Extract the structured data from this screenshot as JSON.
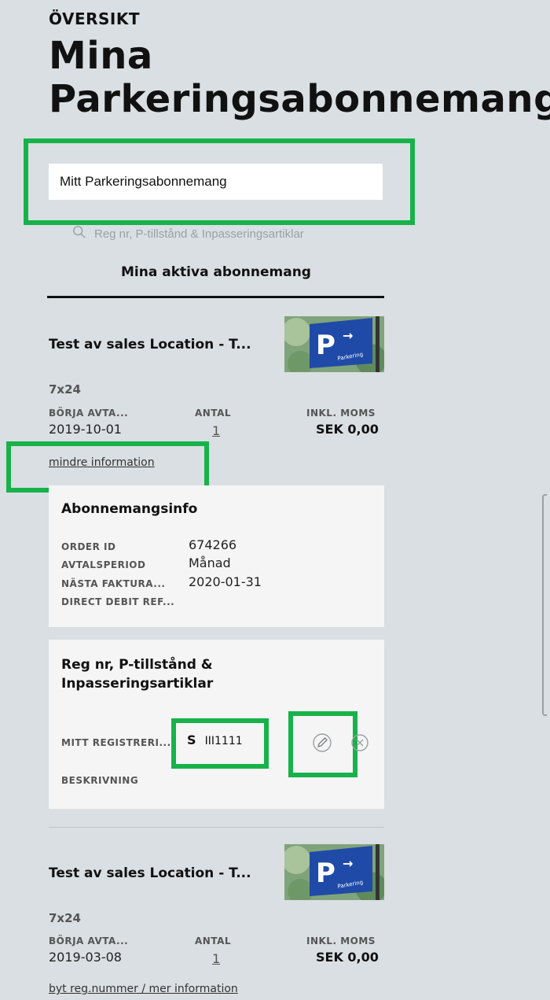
{
  "header": {
    "eyebrow": "ÖVERSIKT",
    "title_line1": "Mina",
    "title_line2": "Parkeringsabonnemang"
  },
  "selector": {
    "value": "Mitt Parkeringsabonnemang"
  },
  "search": {
    "placeholder": "Reg nr, P-tillstånd & Inpasseringsartiklar"
  },
  "tabs": {
    "active": "Mina aktiva abonnemang"
  },
  "subscriptions": [
    {
      "title": "Test av sales Location - T...",
      "plan": "7x24",
      "start_label": "BÖRJA AVTA...",
      "start_value": "2019-10-01",
      "qty_label": "ANTAL",
      "qty_value": "1",
      "price_label": "INKL. MOMS",
      "price_value": "SEK 0,00",
      "toggle_link": "mindre information",
      "info": {
        "heading": "Abonnemangsinfo",
        "order_id_label": "ORDER ID",
        "order_id_value": "674266",
        "period_label": "AVTALSPERIOD",
        "period_value": "Månad",
        "next_invoice_label": "NÄSTA FAKTURA...",
        "next_invoice_value": "2020-01-31",
        "debit_label": "DIRECT DEBIT REF..."
      },
      "vehicles": {
        "heading_line1": "Reg nr, P-tillstånd &",
        "heading_line2": "Inpasseringsartiklar",
        "reg_label": "MITT REGISTRERI...",
        "reg_country": "S",
        "reg_value": "III1111",
        "desc_label": "BESKRIVNING"
      }
    },
    {
      "title": "Test av sales Location - T...",
      "plan": "7x24",
      "start_label": "BÖRJA AVTA...",
      "start_value": "2019-03-08",
      "qty_label": "ANTAL",
      "qty_value": "1",
      "price_label": "INKL. MOMS",
      "price_value": "SEK 0,00",
      "toggle_link": "byt reg.nummer / mer information"
    }
  ],
  "thumbnail": {
    "sign_letter": "P",
    "sign_arrow": "→",
    "sign_text": "Parkering"
  },
  "icons": [
    "search-icon",
    "edit-pencil-icon",
    "remove-circle-x-icon"
  ],
  "colors": {
    "background": "#d9dfe2",
    "highlight": "#17b24a",
    "panel": "#f5f5f5"
  }
}
